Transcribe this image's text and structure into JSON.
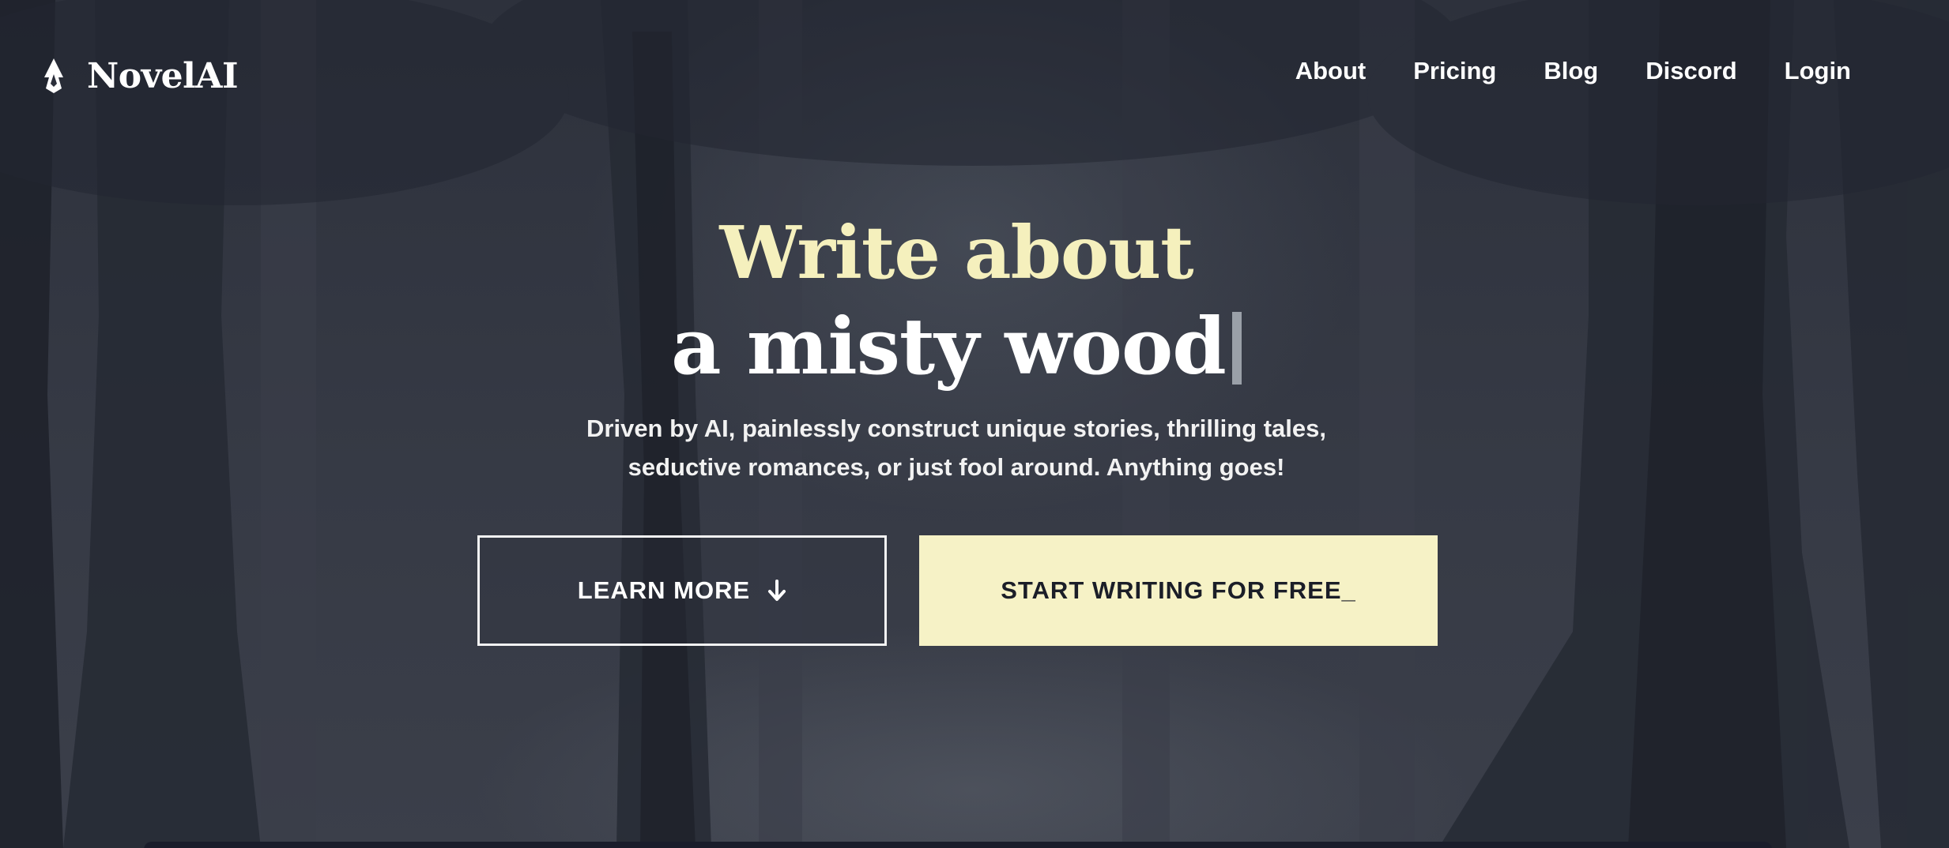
{
  "brand": {
    "name": "NovelAI",
    "logo_icon": "quill-pen-icon"
  },
  "nav": {
    "items": [
      {
        "label": "About"
      },
      {
        "label": "Pricing"
      },
      {
        "label": "Blog"
      },
      {
        "label": "Discord"
      },
      {
        "label": "Login"
      }
    ]
  },
  "hero": {
    "headline_top": "Write about",
    "headline_typed": "a misty wood",
    "subtitle_line1": "Driven by AI, painlessly construct unique stories, thrilling tales,",
    "subtitle_line2": "seductive romances, or just fool around. Anything goes!"
  },
  "actions": {
    "learn_more_label": "LEARN MORE",
    "learn_more_icon": "arrow-down-icon",
    "start_label": "START WRITING FOR FREE_"
  },
  "colors": {
    "background": "#2b2f3b",
    "accent_cream": "#f6f2c6",
    "headline_cream": "#f5f0bd",
    "button_text_dark": "#1b1e28"
  }
}
